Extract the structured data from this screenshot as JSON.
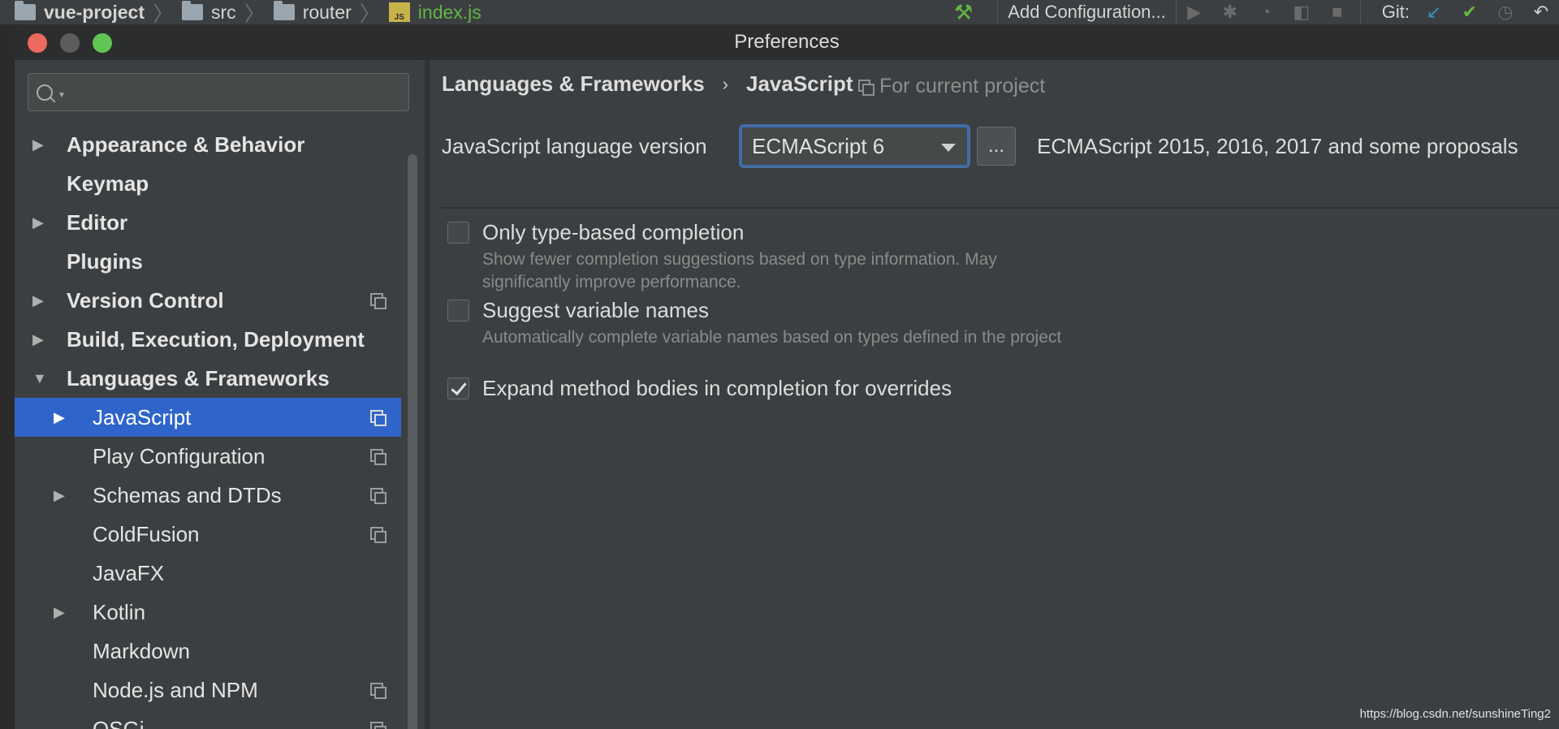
{
  "ide_toolbar": {
    "breadcrumb": [
      {
        "label": "vue-project",
        "icon": "project-icon"
      },
      {
        "label": "src",
        "icon": "folder-icon"
      },
      {
        "label": "router",
        "icon": "folder-icon"
      },
      {
        "label": "index.js",
        "icon": "js-file-icon"
      }
    ],
    "add_configuration_label": "Add Configuration...",
    "git_label": "Git:"
  },
  "dialog": {
    "title": "Preferences",
    "search_placeholder": "",
    "tree": [
      {
        "label": "Appearance & Behavior",
        "level": 0,
        "expandable": true,
        "expanded": false,
        "project_icon": false,
        "selected": false
      },
      {
        "label": "Keymap",
        "level": 0,
        "expandable": false,
        "expanded": false,
        "project_icon": false,
        "selected": false
      },
      {
        "label": "Editor",
        "level": 0,
        "expandable": true,
        "expanded": false,
        "project_icon": false,
        "selected": false
      },
      {
        "label": "Plugins",
        "level": 0,
        "expandable": false,
        "expanded": false,
        "project_icon": false,
        "selected": false
      },
      {
        "label": "Version Control",
        "level": 0,
        "expandable": true,
        "expanded": false,
        "project_icon": true,
        "selected": false
      },
      {
        "label": "Build, Execution, Deployment",
        "level": 0,
        "expandable": true,
        "expanded": false,
        "project_icon": false,
        "selected": false
      },
      {
        "label": "Languages & Frameworks",
        "level": 0,
        "expandable": true,
        "expanded": true,
        "project_icon": false,
        "selected": false
      },
      {
        "label": "JavaScript",
        "level": 1,
        "expandable": true,
        "expanded": false,
        "project_icon": true,
        "selected": true
      },
      {
        "label": "Play Configuration",
        "level": 1,
        "expandable": false,
        "expanded": false,
        "project_icon": true,
        "selected": false
      },
      {
        "label": "Schemas and DTDs",
        "level": 1,
        "expandable": true,
        "expanded": false,
        "project_icon": true,
        "selected": false
      },
      {
        "label": "ColdFusion",
        "level": 1,
        "expandable": false,
        "expanded": false,
        "project_icon": true,
        "selected": false
      },
      {
        "label": "JavaFX",
        "level": 1,
        "expandable": false,
        "expanded": false,
        "project_icon": false,
        "selected": false
      },
      {
        "label": "Kotlin",
        "level": 1,
        "expandable": true,
        "expanded": false,
        "project_icon": false,
        "selected": false
      },
      {
        "label": "Markdown",
        "level": 1,
        "expandable": false,
        "expanded": false,
        "project_icon": false,
        "selected": false
      },
      {
        "label": "Node.js and NPM",
        "level": 1,
        "expandable": false,
        "expanded": false,
        "project_icon": true,
        "selected": false
      },
      {
        "label": "OSGi",
        "level": 1,
        "expandable": false,
        "expanded": false,
        "project_icon": true,
        "selected": false
      }
    ],
    "main": {
      "breadcrumb_parent": "Languages & Frameworks",
      "breadcrumb_separator": "›",
      "breadcrumb_current": "JavaScript",
      "for_current_project": "For current project",
      "lang_version_label": "JavaScript language version",
      "lang_version_value": "ECMAScript 6",
      "dots_button": "...",
      "lang_version_desc": "ECMAScript 2015, 2016, 2017 and some proposals",
      "options": [
        {
          "title": "Only type-based completion",
          "desc": "Show fewer completion suggestions based on type information. May significantly improve performance.",
          "checked": false
        },
        {
          "title": "Suggest variable names",
          "desc": "Automatically complete variable names based on types defined in the project",
          "checked": false
        },
        {
          "title": "Expand method bodies in completion for overrides",
          "desc": "",
          "checked": true
        }
      ]
    }
  },
  "watermark": "https://blog.csdn.net/sunshineTing2",
  "colors": {
    "selection": "#2f65ca",
    "background": "#3c3f41",
    "text": "#dcdcdc",
    "accent_green": "#62b543",
    "git_blue": "#3592c4"
  }
}
